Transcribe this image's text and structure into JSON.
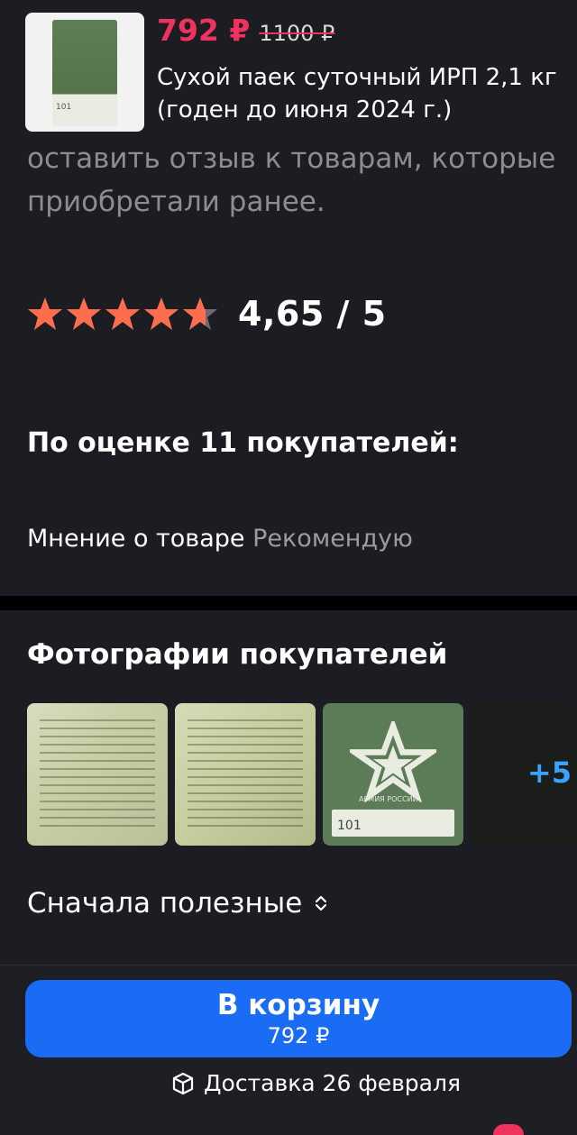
{
  "product": {
    "price_now": "792 ₽",
    "price_old": "1100 ₽",
    "title": "Сухой паек суточный ИРП 2,1 кг  (годен до  июня 2024 г.)",
    "thumb_code": "101"
  },
  "intro": {
    "line1": "оставить отзыв к товарам, которые",
    "line2": "приобретали ранее."
  },
  "rating": {
    "value": 4.65,
    "text": "4,65 / 5",
    "star_color": "#ff6d4d",
    "star_empty_color": "#6c6c70"
  },
  "reviews": {
    "count_text": "По оценке 11 покупателей:"
  },
  "opinion": {
    "label": "Мнение о товаре",
    "value": "Рекомендую"
  },
  "photos": {
    "title": "Фотографии покупателей",
    "more": "+5",
    "photo3_brand": "АРМИЯ РОССИИ",
    "photo3_code": "101"
  },
  "sort": {
    "label": "Сначала полезные",
    "icon": "sort-updown-icon"
  },
  "cart": {
    "label": "В корзину",
    "price": "792 ₽",
    "color": "#1a6cf5"
  },
  "delivery": {
    "icon": "box-icon",
    "text": "Доставка 26 февраля"
  },
  "colors": {
    "accent": "#f0325f",
    "background": "#1c1d22",
    "link": "#3aa2ff"
  }
}
